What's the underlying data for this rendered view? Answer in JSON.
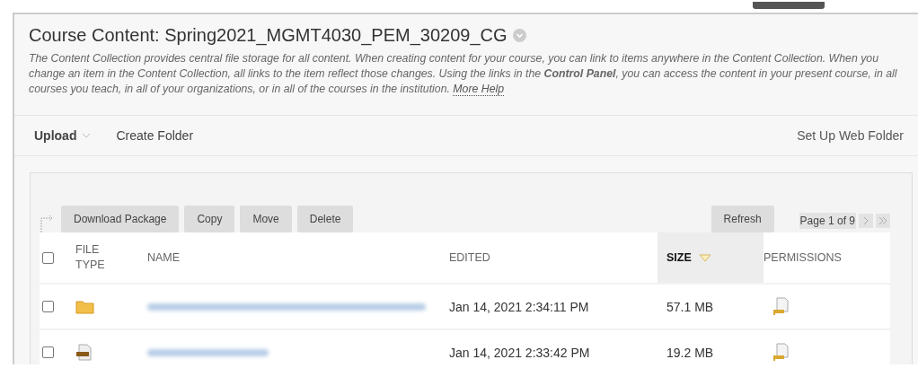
{
  "page": {
    "title": "Course Content: Spring2021_MGMT4030_PEM_30209_CG",
    "description": "The Content Collection provides central file storage for all content. When creating content for your course, you can link to items anywhere in the Content Collection. When you change an item in the Content Collection, all links to the item reflect those changes. Using the links in the **Control Panel**, you can access the content in your present course, in all courses you teach, in all of your organizations, or in all of the courses in the institution.",
    "help_link": "More Help"
  },
  "toolbar": {
    "items": [
      {
        "label": "Upload",
        "kind": "menu"
      },
      {
        "label": "Create Folder",
        "kind": "link"
      }
    ],
    "right_link": "Set Up Web Folder"
  },
  "actions": [
    "Download Package",
    "Copy",
    "Move",
    "Delete"
  ],
  "refresh": "Refresh",
  "pagination": {
    "label": "Page 1 of 9"
  },
  "table": {
    "select_all": {
      "checked": false
    },
    "columns": [
      {
        "label": "FILE TYPE",
        "sorted": false
      },
      {
        "label": "NAME",
        "sorted": false
      },
      {
        "label": "EDITED",
        "sorted": false
      },
      {
        "label": "SIZE",
        "sorted": true
      },
      {
        "label": "PERMISSIONS",
        "sorted": false
      }
    ],
    "rows": [
      {
        "checked": false,
        "kind": "folder",
        "edited": "Jan 14, 2021 2:34:11 PM",
        "size": "57.1 MB"
      },
      {
        "checked": false,
        "kind": "pdf",
        "edited": "Jan 14, 2021 2:33:42 PM",
        "size": "19.2 MB"
      }
    ]
  }
}
